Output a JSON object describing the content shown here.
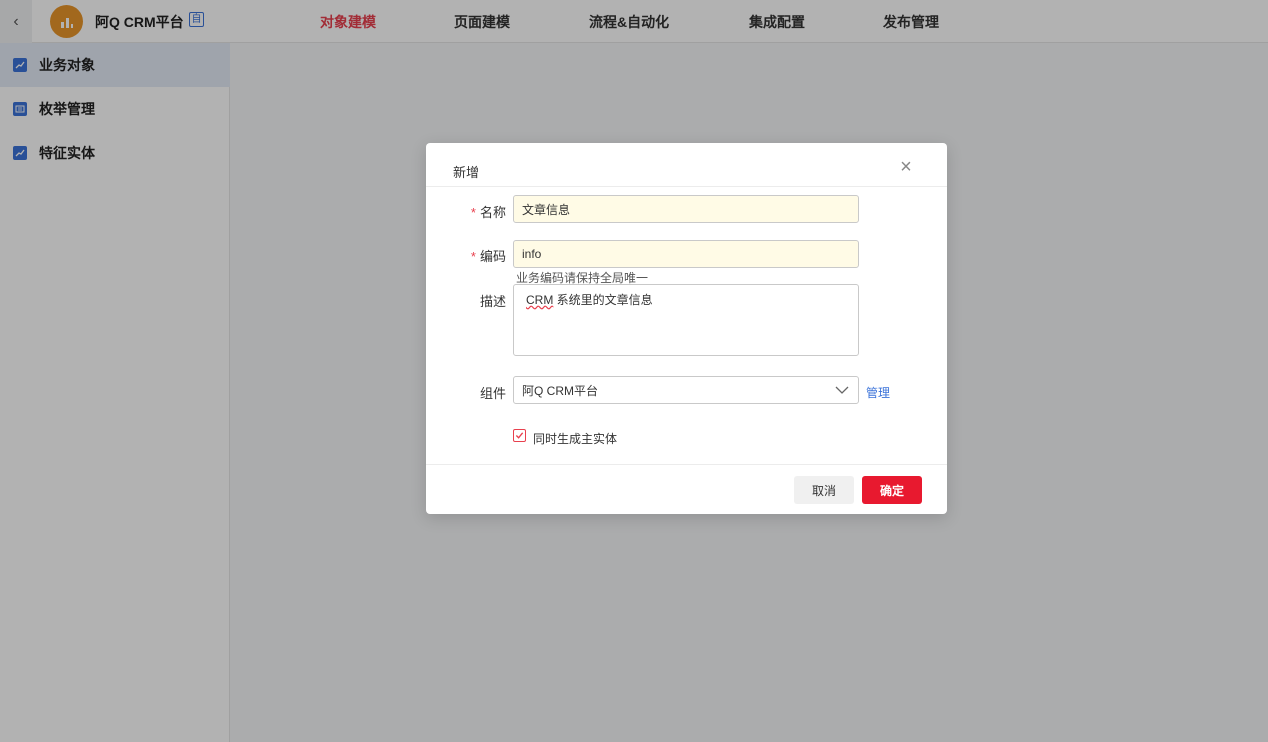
{
  "header": {
    "back_icon": "chevron-left-icon",
    "app_name": "阿Q CRM平台",
    "app_badge": "自",
    "tabs": [
      {
        "label": "对象建模",
        "active": true
      },
      {
        "label": "页面建模",
        "active": false
      },
      {
        "label": "流程&自动化",
        "active": false
      },
      {
        "label": "集成配置",
        "active": false
      },
      {
        "label": "发布管理",
        "active": false
      }
    ]
  },
  "sidebar": {
    "items": [
      {
        "label": "业务对象",
        "icon": "object-icon",
        "active": true
      },
      {
        "label": "枚举管理",
        "icon": "enum-icon",
        "active": false
      },
      {
        "label": "特征实体",
        "icon": "entity-icon",
        "active": false
      }
    ]
  },
  "modal": {
    "title": "新增",
    "close_icon": "close-icon",
    "fields": {
      "name": {
        "label": "名称",
        "required_mark": "*",
        "value": "文章信息"
      },
      "code": {
        "label": "编码",
        "required_mark": "*",
        "value": "info",
        "hint": "业务编码请保持全局唯一"
      },
      "description": {
        "label": "描述",
        "value_prefix": "CRM",
        "value_rest": " 系统里的文章信息"
      },
      "component": {
        "label": "组件",
        "value": "阿Q CRM平台",
        "manage_link": "管理"
      }
    },
    "checkbox": {
      "label": "同时生成主实体",
      "checked": true
    },
    "buttons": {
      "cancel": "取消",
      "ok": "确定"
    }
  },
  "colors": {
    "accent": "#e8404e",
    "primary_button": "#e8192f",
    "link": "#3b73d9",
    "input_bg": "#fffbe6"
  }
}
